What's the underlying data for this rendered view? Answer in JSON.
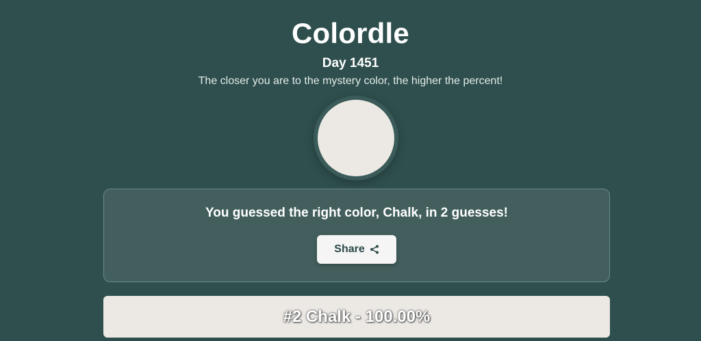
{
  "header": {
    "title": "Colordle",
    "day": "Day 1451",
    "subtitle": "The closer you are to the mystery color, the higher the percent!"
  },
  "mystery_color": {
    "hex": "#ece9e4"
  },
  "result": {
    "message": "You guessed the right color, Chalk, in 2 guesses!",
    "share_label": "Share",
    "share_icon": "share-icon"
  },
  "guesses": [
    {
      "label": "#2 Chalk - 100.00%",
      "color": "#ece9e4"
    }
  ],
  "colors": {
    "background": "#2e4f4d",
    "panel": "#425f5d",
    "panel_border": "#6c8a87",
    "button_bg": "#f4f5f4",
    "button_text": "#2b4a48"
  }
}
